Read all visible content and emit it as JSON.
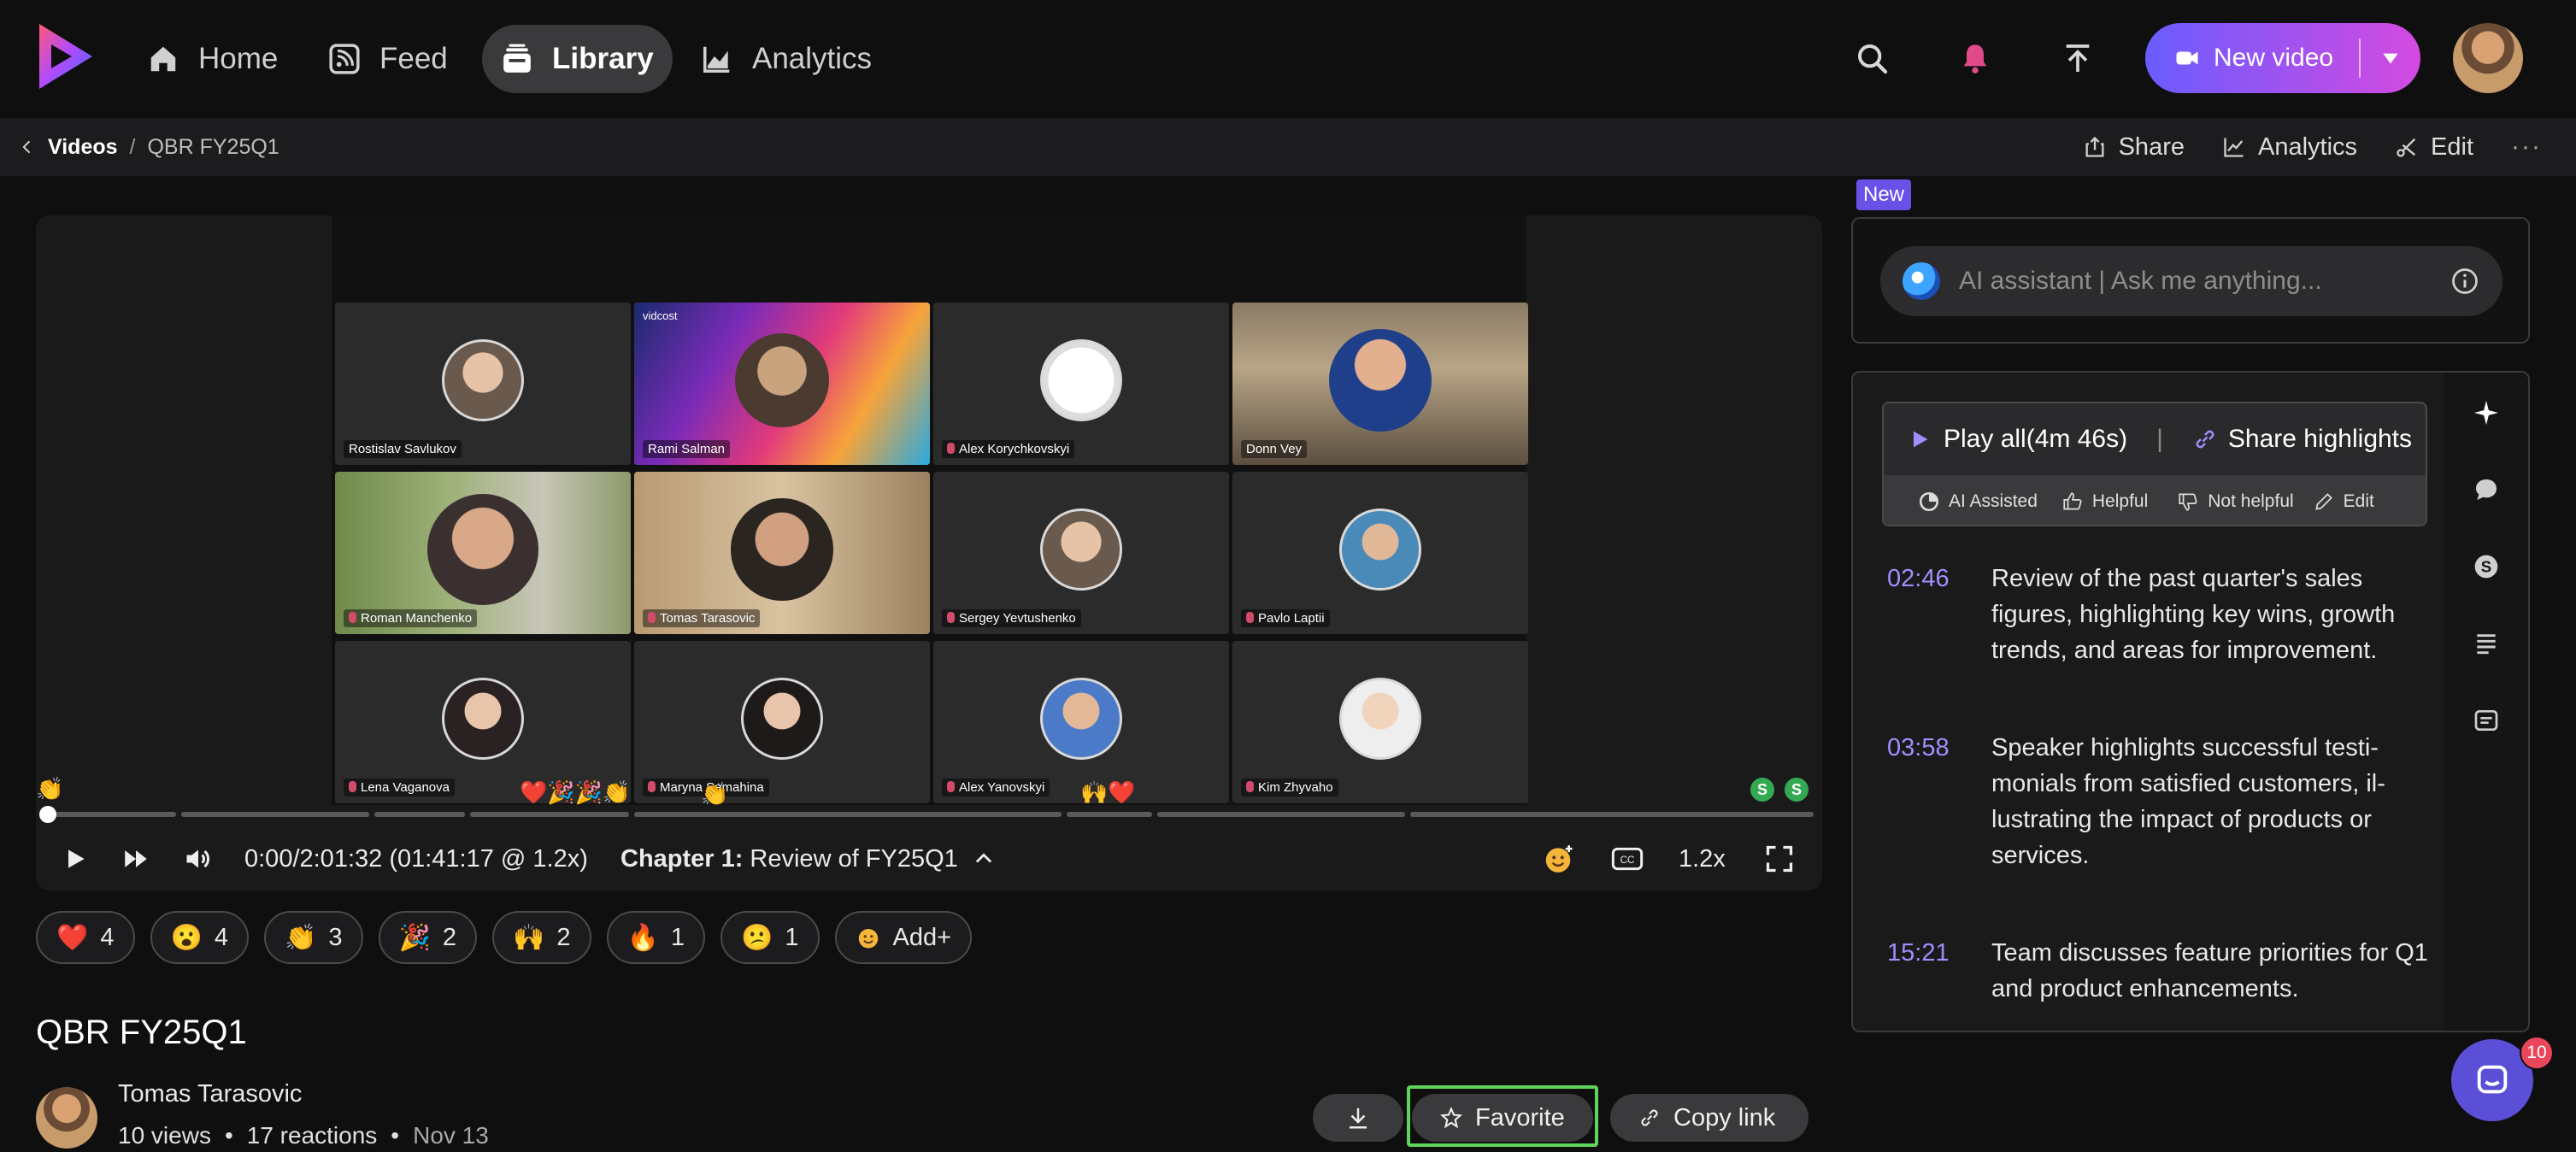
{
  "nav": {
    "items": [
      {
        "label": "Home",
        "icon": "home-icon"
      },
      {
        "label": "Feed",
        "icon": "rss-icon"
      },
      {
        "label": "Library",
        "icon": "library-icon"
      },
      {
        "label": "Analytics",
        "icon": "chart-icon"
      }
    ],
    "new_video_label": "New video"
  },
  "breadcrumb": {
    "parent": "Videos",
    "separator": "/",
    "current": "QBR FY25Q1"
  },
  "header_actions": {
    "share": "Share",
    "analytics": "Analytics",
    "edit": "Edit",
    "more": "···"
  },
  "video": {
    "brand_tag": "vidcost",
    "participants": [
      "Rostislav Savlukov",
      "Rami Salman",
      "Alex Korychkovskyi",
      "Donn Vey",
      "Roman Manchenko",
      "Tomas Tarasovic",
      "Sergey Yevtushenko",
      "Pavlo Laptii",
      "Lena Vaganova",
      "Maryna Semahina",
      "Alex Yanovskyi",
      "Kim Zhyvaho"
    ],
    "time": "0:00/2:01:32 (01:41:17 @ 1.2x)",
    "chapter_prefix": "Chapter 1:",
    "chapter_title": "Review of FY25Q1",
    "speed": "1.2x",
    "presence_badge": "S"
  },
  "reactions": [
    {
      "emoji": "❤️",
      "count": "4"
    },
    {
      "emoji": "😮",
      "count": "4"
    },
    {
      "emoji": "👏",
      "count": "3"
    },
    {
      "emoji": "🎉",
      "count": "2"
    },
    {
      "emoji": "🙌",
      "count": "2"
    },
    {
      "emoji": "🔥",
      "count": "1"
    },
    {
      "emoji": "😕",
      "count": "1"
    }
  ],
  "add_reaction_label": "Add+",
  "title": "QBR FY25Q1",
  "author": {
    "name": "Tomas Tarasovic",
    "views": "10 views",
    "reactions": "17 reactions",
    "date": "Nov 13",
    "dot": "•"
  },
  "actions": {
    "favorite": "Favorite",
    "copy_link": "Copy link"
  },
  "assistant": {
    "badge": "New",
    "placeholder": "AI assistant | Ask me anything..."
  },
  "highlights": {
    "play_all": "Play all",
    "duration": "(4m 46s)",
    "share": "Share highlights",
    "divider": "|",
    "ai_assisted": "AI Assisted",
    "helpful": "Helpful",
    "not_helpful": "Not helpful",
    "edit": "Edit",
    "items": [
      {
        "time": "02:46",
        "text": "Review of the past quarter's sales figures, highlighting key wins, growth trends, and areas for improvement."
      },
      {
        "time": "03:58",
        "text": "Speaker highlights successful testi-monials from satisfied customers, il-lustrating the impact of products or services."
      },
      {
        "time": "15:21",
        "text": "Team discusses feature priorities for Q1 and product enhancements."
      }
    ]
  },
  "chat_unread": "10",
  "colors": {
    "accent_purple": "#6a5cff",
    "accent_pink": "#d44ae0",
    "highlight_time": "#a48cff",
    "focus_outline": "#5fd35a"
  }
}
